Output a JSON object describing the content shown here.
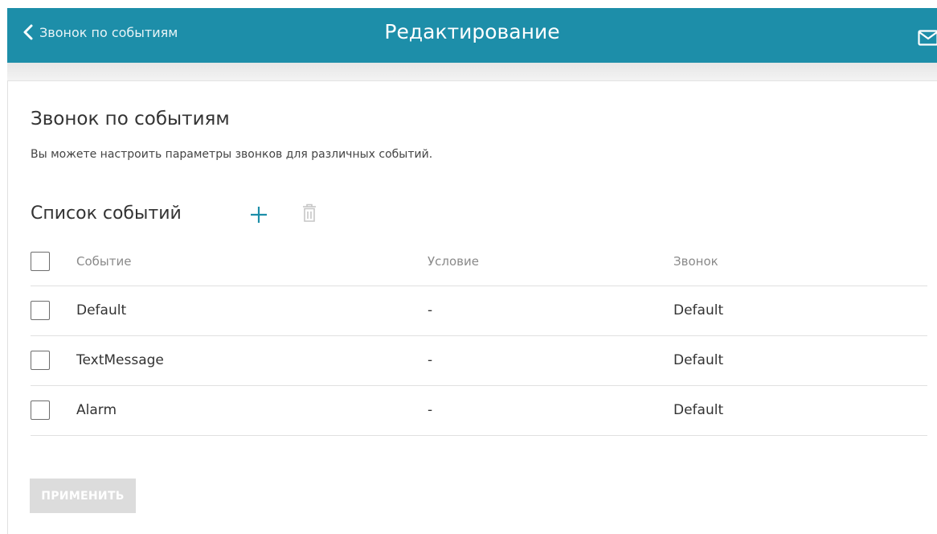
{
  "header": {
    "back_label": "Звонок по событиям",
    "title": "Редактирование",
    "icons": {
      "back": "chevron-left-icon",
      "mail": "mail-icon"
    },
    "background_color": "#1d8ea9"
  },
  "section": {
    "title": "Звонок по событиям",
    "description": "Вы можете настроить параметры звонков для различных событий."
  },
  "events_list": {
    "title": "Список событий",
    "add_icon": "plus-icon",
    "delete_icon": "trash-icon",
    "columns": [
      "Событие",
      "Условие",
      "Звонок"
    ],
    "rows": [
      {
        "event": "Default",
        "condition": "-",
        "call": "Default",
        "checked": false
      },
      {
        "event": "TextMessage",
        "condition": "-",
        "call": "Default",
        "checked": false
      },
      {
        "event": "Alarm",
        "condition": "-",
        "call": "Default",
        "checked": false
      }
    ]
  },
  "apply_label": "ПРИМЕНИТЬ",
  "colors": {
    "accent": "#1d8ea9",
    "disabled_button": "#dcdcdc"
  }
}
